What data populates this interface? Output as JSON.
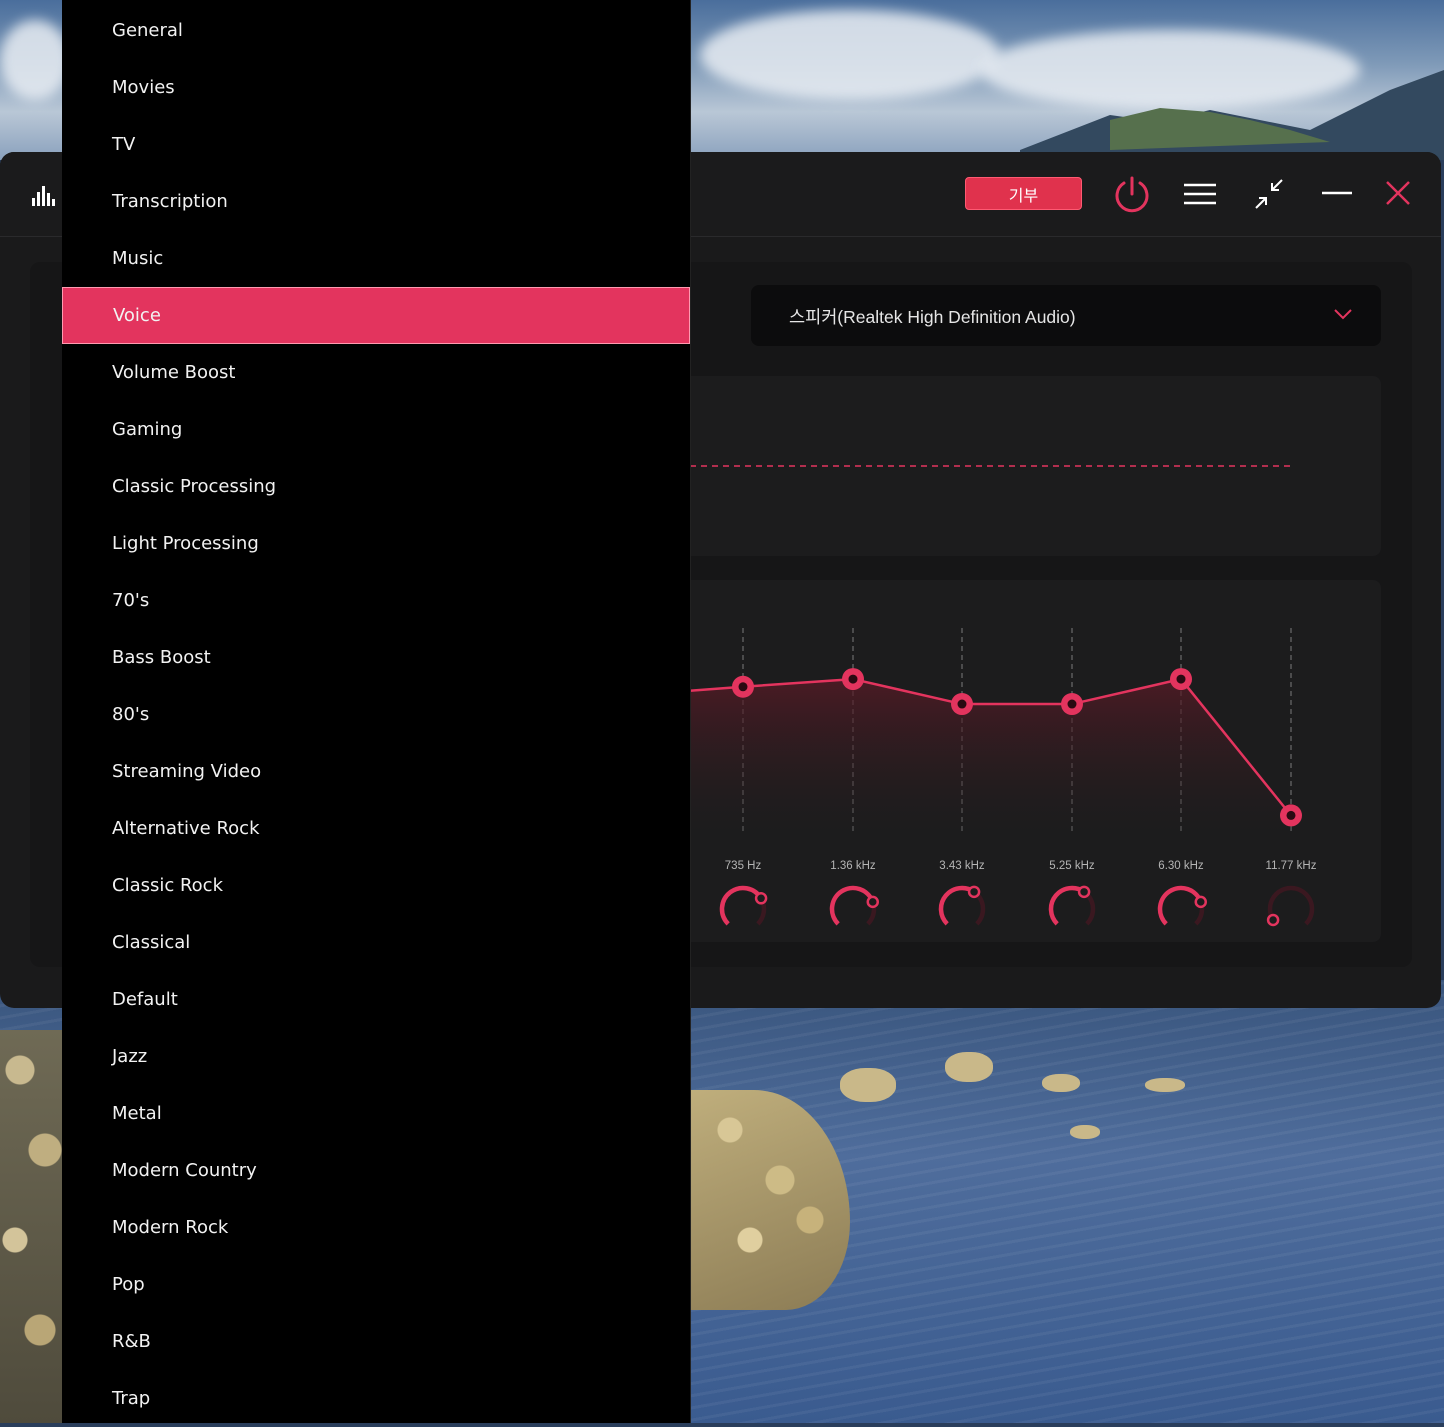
{
  "window": {
    "donate_label": "기부",
    "device_select": {
      "value": "스피커(Realtek High Definition Audio)"
    },
    "icons": [
      "equalizer-logo-icon",
      "power-icon",
      "hamburger-menu-icon",
      "collapse-arrows-icon",
      "minimize-icon",
      "close-icon"
    ]
  },
  "preset_menu": {
    "selected": "Voice",
    "items": [
      "General",
      "Movies",
      "TV",
      "Transcription",
      "Music",
      "Voice",
      "Volume Boost",
      "Gaming",
      "Classic Processing",
      "Light Processing",
      "70's",
      "Bass Boost",
      "80's",
      "Streaming Video",
      "Alternative Rock",
      "Classic Rock",
      "Classical",
      "Default",
      "Jazz",
      "Metal",
      "Modern Country",
      "Modern Rock",
      "Pop",
      "R&B",
      "Trap"
    ]
  },
  "eq": {
    "bands": [
      {
        "label": "735 Hz",
        "level": 0.72
      },
      {
        "label": "1.36 kHz",
        "level": 0.76
      },
      {
        "label": "3.43 kHz",
        "level": 0.63
      },
      {
        "label": "5.25 kHz",
        "level": 0.63
      },
      {
        "label": "6.30 kHz",
        "level": 0.76
      },
      {
        "label": "11.77 kHz",
        "level": 0.05
      }
    ]
  },
  "colors": {
    "accent": "#e3345e",
    "window_bg": "#1a1a1b",
    "menu_bg": "#000000",
    "panel_bg": "#1c1c1d"
  }
}
